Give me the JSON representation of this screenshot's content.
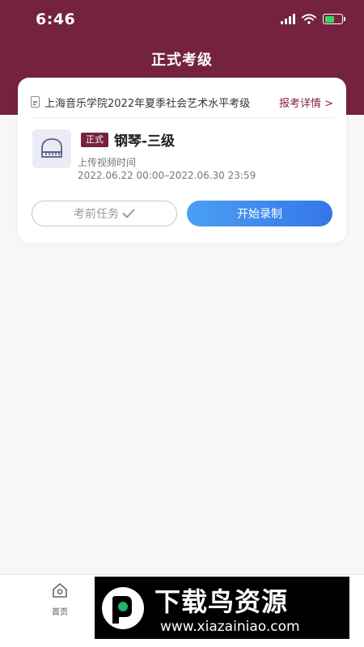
{
  "status_bar": {
    "time": "6:46"
  },
  "page": {
    "title": "正式考级"
  },
  "exam_card": {
    "exam_name": "上海音乐学院2022年夏季社会艺术水平考级",
    "details_link": "报考详情 >",
    "badge": "正式",
    "grade_title": "钢琴-三级",
    "upload_label": "上传视频时间",
    "upload_range": "2022.06.22 00:00–2022.06.30 23:59",
    "pre_exam_tasks_label": "考前任务",
    "start_recording_label": "开始录制"
  },
  "tab_bar": {
    "home_label": "首页"
  },
  "watermark": {
    "title": "下载鸟资源",
    "url": "www.xiazainiao.com"
  },
  "colors": {
    "brand": "#74223f",
    "accent_blue": "#3576e8",
    "link": "#8b2140"
  },
  "icons": [
    "signal-icon",
    "wifi-icon",
    "battery-icon",
    "document-icon",
    "piano-icon",
    "checkmark-icon",
    "home-icon"
  ]
}
